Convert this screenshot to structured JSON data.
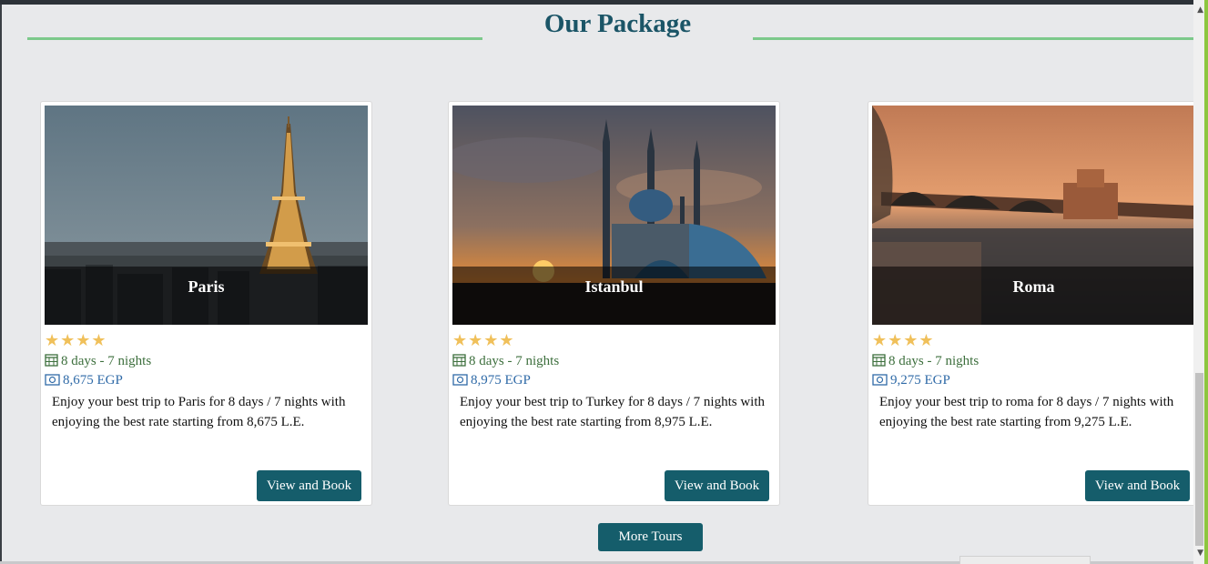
{
  "section": {
    "title": "Our Package"
  },
  "packages": [
    {
      "city": "Paris",
      "rating": 4,
      "duration": "8 days - 7 nights",
      "price": "8,675 EGP",
      "description": "Enjoy your best trip to Paris for 8 days / 7 nights with enjoying the best rate starting from 8,675 L.E.",
      "button_label": "View and Book"
    },
    {
      "city": "Istanbul",
      "rating": 4,
      "duration": "8 days - 7 nights",
      "price": "8,975 EGP",
      "description": "Enjoy your best trip to Turkey for 8 days / 7 nights with enjoying the best rate starting from 8,975 L.E.",
      "button_label": "View and Book"
    },
    {
      "city": "Roma",
      "rating": 4,
      "duration": "8 days - 7 nights",
      "price": "9,275 EGP",
      "description": "Enjoy your best trip to roma for 8 days / 7 nights with enjoying the best rate starting from 9,275 L.E.",
      "button_label": "View and Book"
    }
  ],
  "more_button_label": "More Tours",
  "colors": {
    "heading": "#1b5567",
    "accent_line": "#7cc98b",
    "button": "#155d6b",
    "star": "#f0c05a",
    "duration_text": "#3d6f3d",
    "price_text": "#2f6aa7"
  },
  "icons": {
    "star": "star-icon",
    "duration": "calendar-icon",
    "price": "money-icon"
  }
}
